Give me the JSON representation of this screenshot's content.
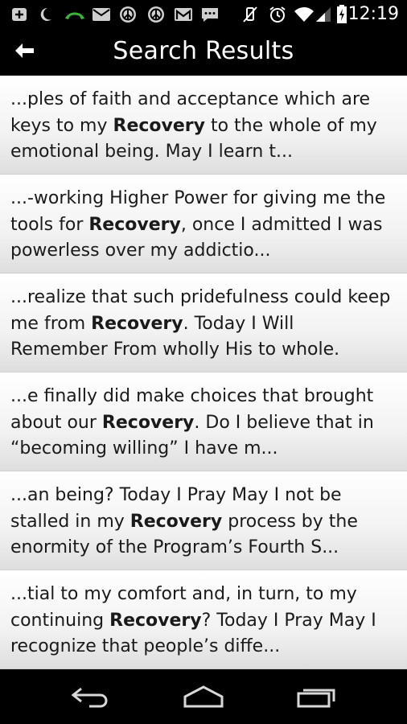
{
  "status_bar": {
    "time": "12:19",
    "left_icons": [
      "add-box-icon",
      "moon-icon",
      "phone-icon",
      "mail-icon",
      "peace-icon",
      "peace-icon",
      "gmail-icon",
      "chat-icon"
    ],
    "right_icons": [
      "vibrate-off-icon",
      "alarm-icon",
      "wifi-icon",
      "signal-icon",
      "battery-charging-icon"
    ]
  },
  "action_bar": {
    "title": "Search Results",
    "back_icon": "arrow-left-icon"
  },
  "search_term": "Recovery",
  "results": [
    {
      "before": "...ples of faith and acceptance which are keys to my ",
      "keyword": "Recovery",
      "after": " to the whole of my emotional being. May I learn t..."
    },
    {
      "before": "...-working Higher Power for giving me the tools for ",
      "keyword": "Recovery",
      "after": ", once I admitted I was powerless over my addictio..."
    },
    {
      "before": "...realize that such pridefulness could keep me from ",
      "keyword": "Recovery",
      "after": ". Today I Will Remember From wholly His to whole."
    },
    {
      "before": "...e finally did make choices that brought about our ",
      "keyword": "Recovery",
      "after": ". Do I believe that in “becoming willing” I have m..."
    },
    {
      "before": "...an being? Today I Pray May I not be stalled in my ",
      "keyword": "Recovery",
      "after": " process by the enormity of the Program’s Fourth S..."
    },
    {
      "before": "...tial to my comfort and, in turn, to my continuing ",
      "keyword": "Recovery",
      "after": "? Today I Pray May I recognize that people’s diffe..."
    }
  ],
  "nav_bar": {
    "buttons": [
      "back-nav-icon",
      "home-nav-icon",
      "recent-apps-icon"
    ]
  }
}
